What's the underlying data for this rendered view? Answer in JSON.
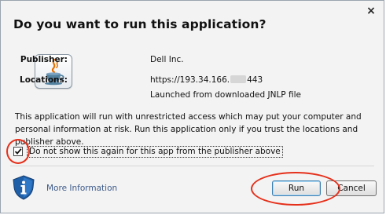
{
  "dialog": {
    "title": "Do you want to run this application?",
    "close_glyph": "×"
  },
  "icons": {
    "app": "java-icon",
    "info": "shield-info-icon",
    "close": "close-icon",
    "check": "checkmark-icon"
  },
  "info": {
    "publisher_label": "Publisher:",
    "publisher_value": "Dell Inc.",
    "locations_label": "Locations:",
    "location_prefix": "https://193.34.166.",
    "location_suffix": "443",
    "location_note": "Launched from downloaded JNLP file"
  },
  "warning": {
    "text": "This application will run with unrestricted access which may put your computer and personal information at risk. Run this application only if you trust the locations and publisher above."
  },
  "checkbox": {
    "checked": true,
    "label": "Do not show this again for this app from the publisher above"
  },
  "footer": {
    "more_info": "More Information",
    "run_label": "Run",
    "cancel_label": "Cancel"
  },
  "colors": {
    "annotation": "#e5301b",
    "link": "#3d5a8a",
    "dialog_bg": "#f3f3f3",
    "shield": "#1f5fa7"
  }
}
